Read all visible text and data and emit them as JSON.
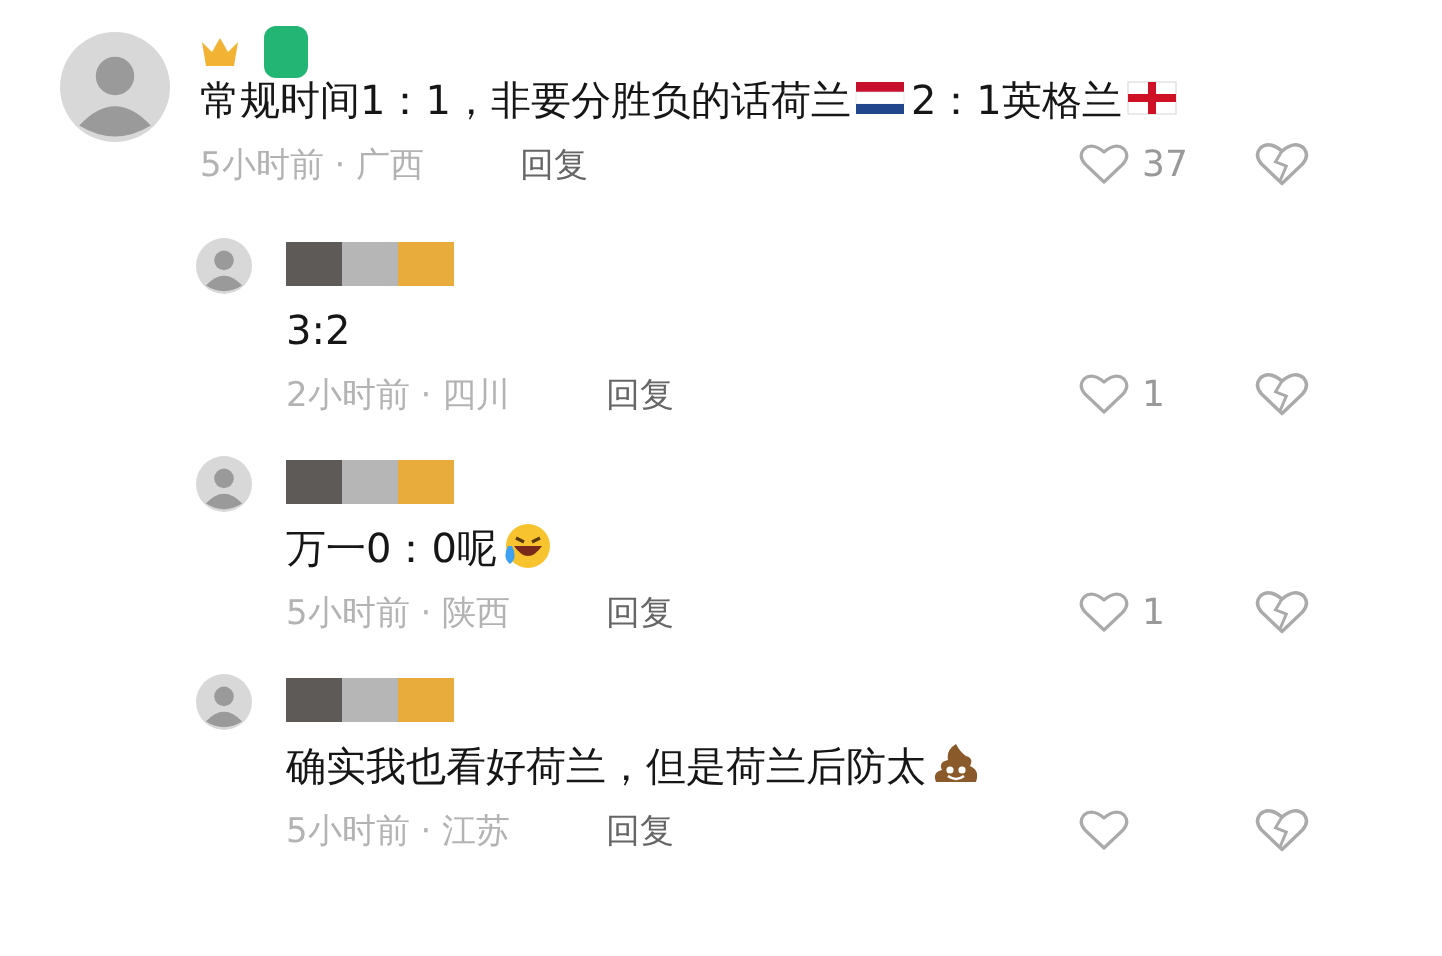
{
  "comments": [
    {
      "kind": "comment",
      "crown": true,
      "segments": [
        {
          "kind": "text",
          "text": "常规时间1：1，非要分胜负的话荷兰"
        },
        {
          "kind": "flag_nl"
        },
        {
          "kind": "text",
          "text": "2：1英格兰"
        },
        {
          "kind": "flag_en"
        }
      ],
      "time": "5小时前 · 广西",
      "reply": "回复",
      "likes": "37"
    },
    {
      "kind": "reply",
      "crown": false,
      "segments": [
        {
          "kind": "text",
          "text": "3:2"
        }
      ],
      "time": "2小时前 · 四川",
      "reply": "回复",
      "likes": "1"
    },
    {
      "kind": "reply",
      "crown": false,
      "segments": [
        {
          "kind": "text",
          "text": "万一0：0呢"
        },
        {
          "kind": "laugh"
        }
      ],
      "time": "5小时前 · 陕西",
      "reply": "回复",
      "likes": "1"
    },
    {
      "kind": "reply",
      "crown": false,
      "segments": [
        {
          "kind": "text",
          "text": "确实我也看好荷兰，但是荷兰后防太"
        },
        {
          "kind": "poop"
        }
      ],
      "time": "5小时前 · 江苏",
      "reply": "回复"
    }
  ]
}
